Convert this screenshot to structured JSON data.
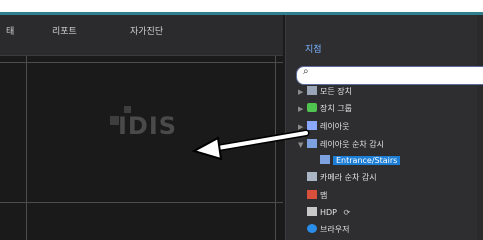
{
  "header": {
    "tabs": [
      {
        "label": "태"
      },
      {
        "label": "리포트"
      },
      {
        "label": "자가진단"
      }
    ]
  },
  "video": {
    "logo_text": "IDIS"
  },
  "panel": {
    "title": "지점",
    "search": {
      "value": "",
      "placeholder": ""
    },
    "items": [
      {
        "label": "모든 장치",
        "icon": "device-icon"
      },
      {
        "label": "장치 그룹",
        "icon": "device-group-icon"
      },
      {
        "label": "레이아웃",
        "icon": "layout-icon"
      },
      {
        "label": "레이아웃 순차 감시",
        "icon": "layout-sequence-icon"
      },
      {
        "label": "Entrance/Stairs",
        "icon": "layout-sequence-icon"
      },
      {
        "label": "카메라 순차 감시",
        "icon": "camera-sequence-icon"
      },
      {
        "label": "맵",
        "icon": "map-icon"
      },
      {
        "label": "HDP",
        "icon": "hdp-icon"
      },
      {
        "label": "브라우저",
        "icon": "browser-icon"
      }
    ]
  },
  "colors": {
    "accent": "#2f7f8f",
    "selection": "#1d7ed6",
    "title": "#7ab3ff"
  }
}
